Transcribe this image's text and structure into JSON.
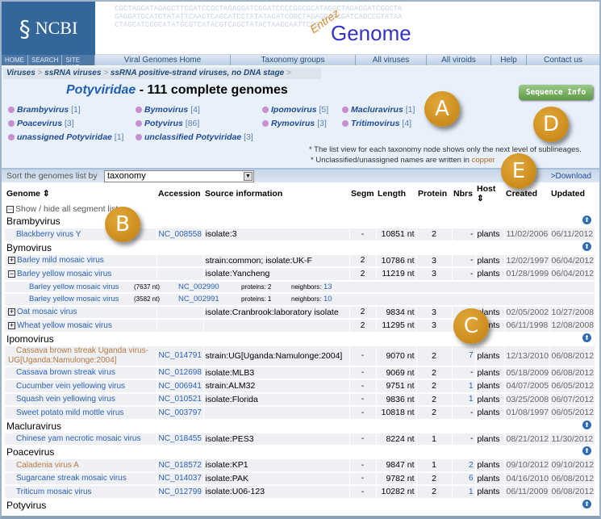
{
  "header": {
    "ncbi_logo": "NCBI",
    "product": "Genome",
    "product_prefix": "Entrez",
    "seq_text": "CGCTAGGATAGAGCTTCGATCCGCTAGAGGATCGGATCCCCGGCGCATAGGCTAGAGGATCGGCTAGAGGATGCATCTATATTCAACTCAGCATCCTATATACATCGGCTAGAGGATCGATCAGCCGTATAACTAGCATCCGCATATGCGTCATACGTCAGCTATACTAACCAATTCGG"
  },
  "nav": {
    "site_links": [
      "HOME",
      "SEARCH",
      "SITE MAP"
    ],
    "items": [
      "Viral Genomes Home",
      "Taxonomy groups",
      "All viruses",
      "All viroids",
      "Help",
      "Contact us"
    ]
  },
  "breadcrumb": [
    "Viruses",
    "ssRNA viruses",
    "ssRNA positive-strand viruses, no DNA stage"
  ],
  "title": {
    "family": "Potyviridae",
    "rest": " - 111 complete genomes"
  },
  "sequence_info_label": "Sequence Info",
  "genera": [
    {
      "name": "Brambyvirus",
      "count": "[1]"
    },
    {
      "name": "Bymovirus",
      "count": "[4]"
    },
    {
      "name": "Ipomovirus",
      "count": "[5]"
    },
    {
      "name": "Macluravirus",
      "count": "[1]"
    },
    {
      "name": "Poacevirus",
      "count": "[3]"
    },
    {
      "name": "Potyvirus",
      "count": "[86]"
    },
    {
      "name": "Rymovirus",
      "count": "[3]"
    },
    {
      "name": "Tritimovirus",
      "count": "[4]"
    },
    {
      "name": "unassigned Potyviridae",
      "count": "[1]"
    },
    {
      "name": "unclassified Potyviridae",
      "count": "[3]"
    }
  ],
  "notes": {
    "line1": "* The list view for each taxonomy node shows only the next level of sublineages.",
    "line2_prefix": "* Unclassified/unassigned names are written in ",
    "line2_copper": "copper"
  },
  "sort": {
    "label": "Sort the genomes list by",
    "value": "taxonomy",
    "download": ">Download"
  },
  "columns": [
    "Genome ⇕",
    "Accession",
    "Source information",
    "Segm",
    "Length",
    "Protein",
    "Nbrs",
    "Host ⇕",
    "Created",
    "Updated"
  ],
  "show_hide": "Show / hide all segment lists",
  "rows": [
    {
      "group": "Brambyvirus"
    },
    {
      "name": "Blackberry virus Y",
      "acc": "NC_008558",
      "src": "isolate:3",
      "segm": "-",
      "len": "10851 nt",
      "prot": "2",
      "nbrs": "-",
      "host": "plants",
      "created": "11/02/2006",
      "updated": "06/11/2012"
    },
    {
      "group": "Bymovirus"
    },
    {
      "name": "Barley mild mosaic virus",
      "toggle": "+",
      "acc": "",
      "src": "strain:common; isolate:UK-F",
      "segm": "2",
      "len": "10786 nt",
      "prot": "3",
      "nbrs": "-",
      "host": "plants",
      "created": "12/02/1997",
      "updated": "06/04/2012"
    },
    {
      "name": "Barley yellow mosaic virus",
      "toggle": "−",
      "acc": "",
      "src": "isolate:Yancheng",
      "segm": "2",
      "len": "11219 nt",
      "prot": "3",
      "nbrs": "-",
      "host": "plants",
      "created": "01/28/1999",
      "updated": "06/04/2012"
    },
    {
      "sub": true,
      "name": "Barley yellow mosaic virus",
      "size": "(7637 nt)",
      "acc": "NC_002990",
      "proteins": "proteins: 2",
      "neighbors_label": "neighbors:",
      "neighbors": "13"
    },
    {
      "sub": true,
      "name": "Barley yellow mosaic virus",
      "size": "(3582 nt)",
      "acc": "NC_002991",
      "proteins": "proteins: 1",
      "neighbors_label": "neighbors:",
      "neighbors": "10"
    },
    {
      "name": "Oat mosaic virus",
      "toggle": "+",
      "acc": "",
      "src": "isolate:Cranbrook:laboratory isolate",
      "segm": "2",
      "len": "9834 nt",
      "prot": "3",
      "nbrs": "-",
      "host": "plants",
      "created": "02/05/2002",
      "updated": "10/27/2008"
    },
    {
      "name": "Wheat yellow mosaic virus",
      "toggle": "+",
      "acc": "",
      "src": "",
      "segm": "2",
      "len": "11295 nt",
      "prot": "3",
      "nbrs": "-",
      "host": "plants",
      "created": "06/11/1998",
      "updated": "12/08/2008"
    },
    {
      "group": "Ipomovirus"
    },
    {
      "name": "Cassava brown streak Uganda virus-UG[Uganda:Namulonge:2004]",
      "copper": true,
      "acc": "NC_014791",
      "src": "strain:UG[Uganda:Namulonge:2004]",
      "segm": "-",
      "len": "9070 nt",
      "prot": "2",
      "nbrs": "7",
      "host": "plants",
      "created": "12/13/2010",
      "updated": "06/08/2012"
    },
    {
      "name": "Cassava brown streak virus",
      "acc": "NC_012698",
      "src": "isolate:MLB3",
      "segm": "-",
      "len": "9069 nt",
      "prot": "2",
      "nbrs": "-",
      "host": "plants",
      "created": "05/18/2009",
      "updated": "06/08/2012"
    },
    {
      "name": "Cucumber vein yellowing virus",
      "acc": "NC_006941",
      "src": "strain:ALM32",
      "segm": "-",
      "len": "9751 nt",
      "prot": "2",
      "nbrs": "1",
      "host": "plants",
      "created": "04/07/2005",
      "updated": "06/05/2012"
    },
    {
      "name": "Squash vein yellowing virus",
      "acc": "NC_010521",
      "src": "isolate:Florida",
      "segm": "-",
      "len": "9836 nt",
      "prot": "2",
      "nbrs": "1",
      "host": "plants",
      "created": "03/25/2008",
      "updated": "06/07/2012"
    },
    {
      "name": "Sweet potato mild mottle virus",
      "acc": "NC_003797",
      "src": "",
      "segm": "-",
      "len": "10818 nt",
      "prot": "2",
      "nbrs": "-",
      "host": "plants",
      "created": "01/08/1997",
      "updated": "06/05/2012"
    },
    {
      "group": "Macluravirus"
    },
    {
      "name": "Chinese yam necrotic mosaic virus",
      "acc": "NC_018455",
      "src": "isolate:PES3",
      "segm": "-",
      "len": "8224 nt",
      "prot": "1",
      "nbrs": "-",
      "host": "plants",
      "created": "08/21/2012",
      "updated": "11/30/2012"
    },
    {
      "group": "Poacevirus"
    },
    {
      "name": "Caladenia virus A",
      "copper": true,
      "acc": "NC_018572",
      "src": "isolate:KP1",
      "segm": "-",
      "len": "9847 nt",
      "prot": "1",
      "nbrs": "2",
      "host": "plants",
      "created": "09/10/2012",
      "updated": "09/10/2012"
    },
    {
      "name": "Sugarcane streak mosaic virus",
      "acc": "NC_014037",
      "src": "isolate:PAK",
      "segm": "-",
      "len": "9782 nt",
      "prot": "2",
      "nbrs": "6",
      "host": "plants",
      "created": "04/16/2010",
      "updated": "06/08/2012"
    },
    {
      "name": "Triticum mosaic virus",
      "acc": "NC_012799",
      "src": "isolate:U06-123",
      "segm": "-",
      "len": "10282 nt",
      "prot": "2",
      "nbrs": "1",
      "host": "plants",
      "created": "06/11/2009",
      "updated": "06/08/2012"
    },
    {
      "group": "Potyvirus"
    }
  ],
  "callouts": [
    "A",
    "B",
    "C",
    "D",
    "E"
  ],
  "colors": {
    "ncbi_blue": "#336699",
    "link": "#2a62b8",
    "copper": "#b87840",
    "callout": "#c98a12",
    "button_green": "#6aa552"
  }
}
